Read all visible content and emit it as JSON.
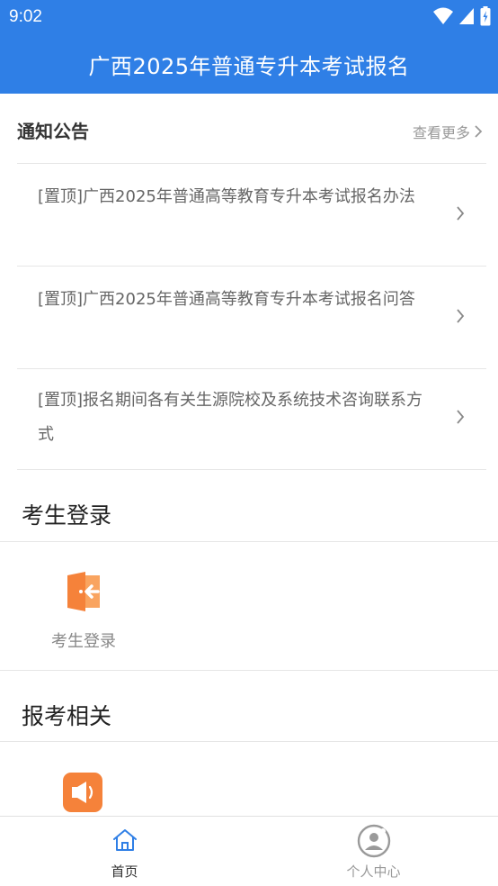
{
  "status_bar": {
    "time": "9:02"
  },
  "app_bar": {
    "title": "广西2025年普通专升本考试报名"
  },
  "notices": {
    "heading": "通知公告",
    "more_label": "查看更多",
    "items": [
      {
        "text": "[置顶]广西2025年普通高等教育专升本考试报名办法"
      },
      {
        "text": "[置顶]广西2025年普通高等教育专升本考试报名问答"
      },
      {
        "text": "[置顶]报名期间各有关生源院校及系统技术咨询联系方式"
      }
    ]
  },
  "login_section": {
    "title": "考生登录",
    "tile_label": "考生登录",
    "tile_icon": "door-enter-icon",
    "icon_color": "#f5823a"
  },
  "exam_section": {
    "title": "报考相关",
    "tile_icon": "megaphone-icon",
    "icon_color": "#f5823a"
  },
  "bottom_nav": {
    "items": [
      {
        "label": "首页",
        "icon": "home-icon",
        "active": true
      },
      {
        "label": "个人中心",
        "icon": "profile-icon",
        "active": false
      }
    ]
  },
  "colors": {
    "primary": "#2f7fe6",
    "accent": "#f5823a",
    "text_muted": "#999999"
  }
}
